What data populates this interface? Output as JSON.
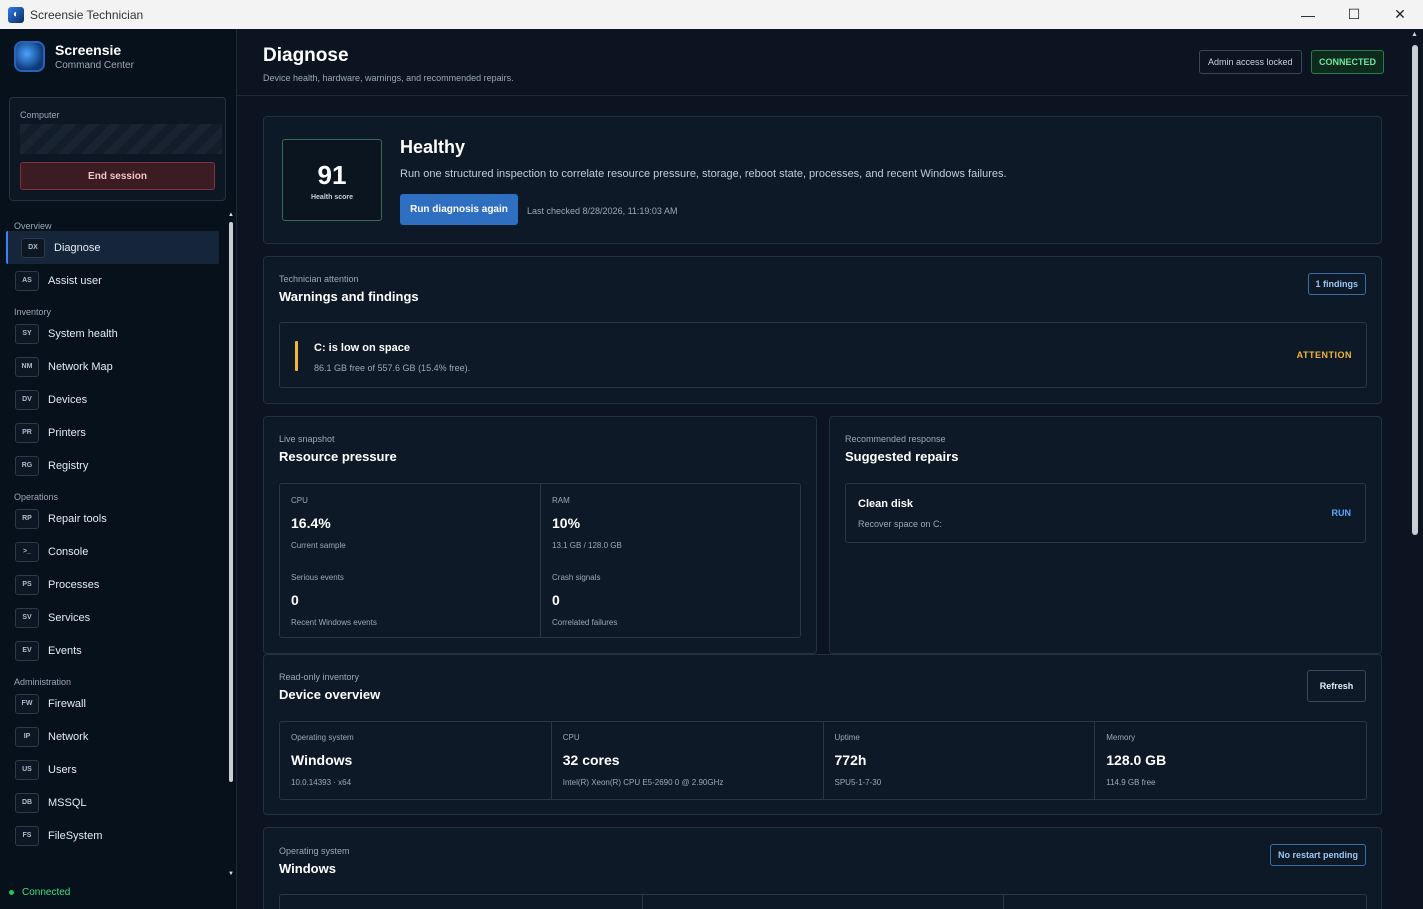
{
  "window": {
    "title": "Screensie Technician"
  },
  "brand": {
    "name": "Screensie",
    "subtitle": "Command Center"
  },
  "computer": {
    "label": "Computer",
    "end_session": "End session"
  },
  "nav": {
    "groups": [
      {
        "label": "Overview",
        "items": [
          {
            "code": "DX",
            "label": "Diagnose"
          },
          {
            "code": "AS",
            "label": "Assist user"
          }
        ]
      },
      {
        "label": "Inventory",
        "items": [
          {
            "code": "SY",
            "label": "System health"
          },
          {
            "code": "NM",
            "label": "Network Map"
          },
          {
            "code": "DV",
            "label": "Devices"
          },
          {
            "code": "PR",
            "label": "Printers"
          },
          {
            "code": "RG",
            "label": "Registry"
          }
        ]
      },
      {
        "label": "Operations",
        "items": [
          {
            "code": "RP",
            "label": "Repair tools"
          },
          {
            "code": ">_",
            "label": "Console"
          },
          {
            "code": "PS",
            "label": "Processes"
          },
          {
            "code": "SV",
            "label": "Services"
          },
          {
            "code": "EV",
            "label": "Events"
          }
        ]
      },
      {
        "label": "Administration",
        "items": [
          {
            "code": "FW",
            "label": "Firewall"
          },
          {
            "code": "IP",
            "label": "Network"
          },
          {
            "code": "US",
            "label": "Users"
          },
          {
            "code": "DB",
            "label": "MSSQL"
          },
          {
            "code": "FS",
            "label": "FileSystem"
          }
        ]
      }
    ],
    "active": "Diagnose"
  },
  "status": {
    "connection": "Connected"
  },
  "header": {
    "title": "Diagnose",
    "subtitle": "Device health, hardware, warnings, and recommended repairs.",
    "admin_badge": "Admin access locked",
    "connection_badge": "CONNECTED"
  },
  "health": {
    "score": "91",
    "score_label": "Health score",
    "status": "Healthy",
    "description": "Run one structured inspection to correlate resource pressure, storage, reboot state, processes, and recent Windows failures.",
    "run_button": "Run diagnosis again",
    "last_checked": "Last checked 8/28/2026, 11:19:03 AM"
  },
  "findings": {
    "eyebrow": "Technician attention",
    "title": "Warnings and findings",
    "badge": "1 findings",
    "items": [
      {
        "title": "C: is low on space",
        "description": "86.1 GB free of 557.6 GB (15.4% free).",
        "severity": "ATTENTION"
      }
    ]
  },
  "resource": {
    "eyebrow": "Live snapshot",
    "title": "Resource pressure",
    "cells": [
      {
        "label": "CPU",
        "value": "16.4%",
        "sub": "Current sample"
      },
      {
        "label": "RAM",
        "value": "10%",
        "sub": "13.1 GB / 128.0 GB"
      },
      {
        "label": "Serious events",
        "value": "0",
        "sub": "Recent Windows events"
      },
      {
        "label": "Crash signals",
        "value": "0",
        "sub": "Correlated failures"
      }
    ]
  },
  "repairs": {
    "eyebrow": "Recommended response",
    "title": "Suggested repairs",
    "items": [
      {
        "title": "Clean disk",
        "description": "Recover space on C:",
        "action": "RUN"
      }
    ]
  },
  "device": {
    "eyebrow": "Read-only inventory",
    "title": "Device overview",
    "refresh": "Refresh",
    "cells": [
      {
        "label": "Operating system",
        "value": "Windows",
        "sub": "10.0.14393 · x64"
      },
      {
        "label": "CPU",
        "value": "32 cores",
        "sub": "Intel(R) Xeon(R) CPU E5-2690 0 @ 2.90GHz"
      },
      {
        "label": "Uptime",
        "value": "772h",
        "sub": "SPU5-1-7-30"
      },
      {
        "label": "Memory",
        "value": "128.0 GB",
        "sub": "114.9 GB free"
      }
    ]
  },
  "os": {
    "eyebrow": "Operating system",
    "title": "Windows",
    "badge": "No restart pending"
  },
  "colors": {
    "accent": "#2e6fc1",
    "warning": "#f5b43a",
    "success": "#22c55e",
    "danger": "#7a3440"
  }
}
